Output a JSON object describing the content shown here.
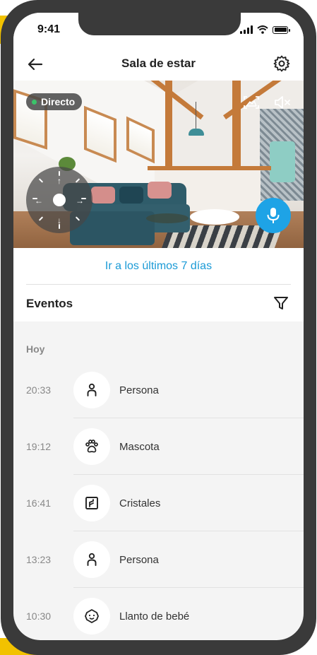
{
  "status_bar": {
    "time": "9:41"
  },
  "header": {
    "title": "Sala de estar",
    "back_icon": "arrow-left-icon",
    "settings_icon": "gear-icon"
  },
  "video": {
    "live_label": "Directo",
    "live_dot_color": "#3bc46a",
    "controls": [
      "screenshot-icon",
      "mute-icon"
    ],
    "joystick_icons": [
      "arrow-up-icon",
      "arrow-down-icon",
      "arrow-left-icon",
      "arrow-right-icon"
    ],
    "mic_icon": "microphone-icon",
    "mic_color": "#1ea3e6"
  },
  "last_days_link": "Ir a los últimos 7 días",
  "events": {
    "title": "Eventos",
    "filter_icon": "filter-icon",
    "section": "Hoy",
    "items": [
      {
        "time": "20:33",
        "label": "Persona",
        "icon": "person-icon"
      },
      {
        "time": "19:12",
        "label": "Mascota",
        "icon": "paw-icon"
      },
      {
        "time": "16:41",
        "label": "Cristales",
        "icon": "glass-break-icon"
      },
      {
        "time": "13:23",
        "label": "Persona",
        "icon": "person-icon"
      },
      {
        "time": "10:30",
        "label": "Llanto de bebé",
        "icon": "baby-face-icon"
      }
    ]
  },
  "accent_color": "#1a9ad6"
}
